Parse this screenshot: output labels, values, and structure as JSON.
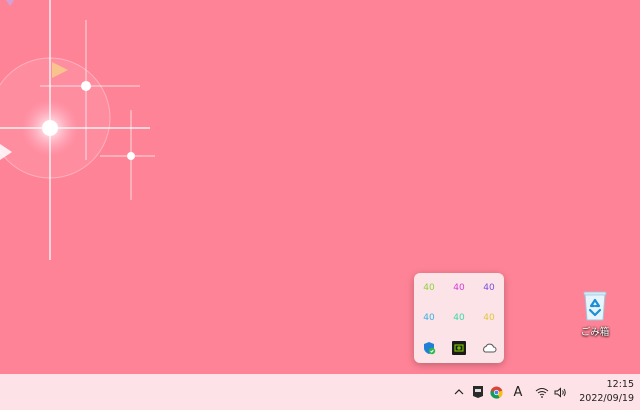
{
  "desktop": {
    "background_color": "#ff8396",
    "recycle_bin": {
      "label": "ごみ箱",
      "icon": "recycle-bin-icon"
    }
  },
  "tray_flyout": {
    "items": [
      {
        "text": "40",
        "color": "#8cd43a",
        "icon": "gpu-monitor-icon"
      },
      {
        "text": "40",
        "color": "#d83ad8",
        "icon": "gpu-monitor-icon"
      },
      {
        "text": "40",
        "color": "#7a4ee0",
        "icon": "gpu-monitor-icon"
      },
      {
        "text": "40",
        "color": "#3ab0e0",
        "icon": "gpu-monitor-icon"
      },
      {
        "text": "40",
        "color": "#3ad8a8",
        "icon": "gpu-monitor-icon"
      },
      {
        "text": "40",
        "color": "#e0c83a",
        "icon": "gpu-monitor-icon"
      },
      {
        "text": "",
        "icon": "windows-security-shield-icon"
      },
      {
        "text": "",
        "icon": "nvidia-icon"
      },
      {
        "text": "",
        "icon": "onedrive-cloud-icon"
      }
    ]
  },
  "taskbar": {
    "overflow_icon": "chevron-up-icon",
    "tray_icons": [
      "epic-games-icon",
      "chrome-icon"
    ],
    "ime_label": "A",
    "network_icon": "wifi-icon",
    "volume_icon": "speaker-icon",
    "clock": {
      "time": "12:15",
      "date": "2022/09/19"
    }
  }
}
